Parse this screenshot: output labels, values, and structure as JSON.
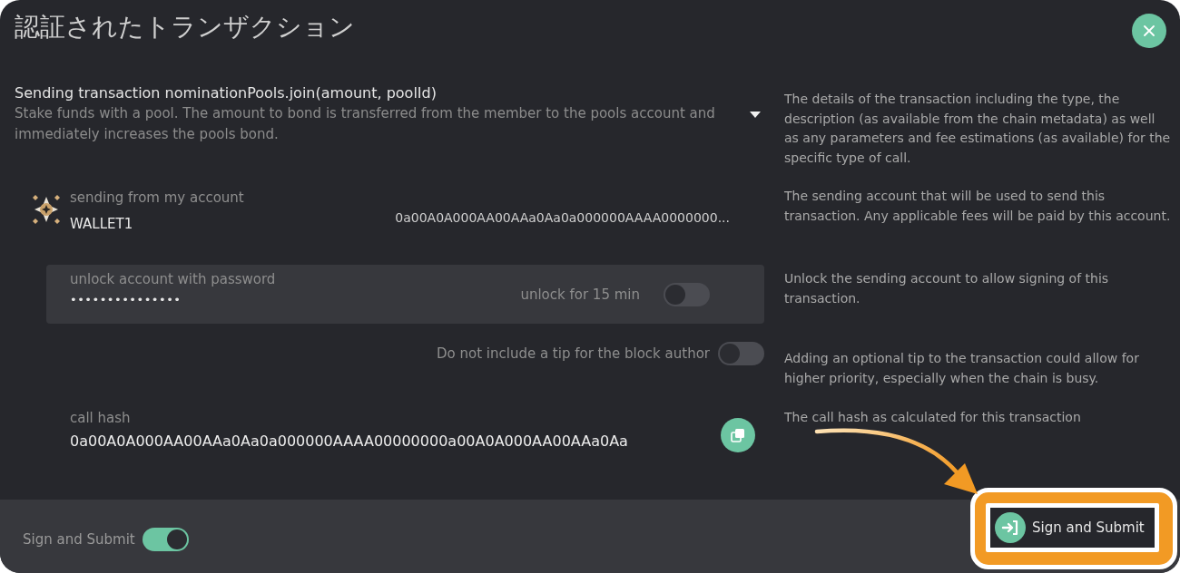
{
  "dialog": {
    "title": "認証されたトランザクション"
  },
  "transaction": {
    "heading": "Sending transaction nominationPools.join(amount, poolId)",
    "description": "Stake funds with a pool. The amount to bond is transferred from the member to the pools account and immediately increases the pools bond.",
    "expanded": false,
    "help": "The details of the transaction including the type, the description (as available from the chain metadata) as well as any parameters and fee estimations (as available) for the specific type of call."
  },
  "sender": {
    "label": "sending from my account",
    "name": "WALLET1",
    "address": "0a00A0A000AA00AAa0Aa0a000000AAAA0000000...",
    "help": "The sending account that will be used to send this transaction. Any applicable fees will be paid by this account."
  },
  "unlock": {
    "label": "unlock account with password",
    "password": "•••••••••••••••",
    "toggle_label": "unlock for 15 min",
    "on": false,
    "help": "Unlock the sending account to allow signing of this transaction."
  },
  "tip": {
    "label": "Do not include a tip for the block author",
    "on": false,
    "help": "Adding an optional tip to the transaction could allow for higher priority, especially when the chain is busy."
  },
  "call_hash": {
    "label": "call hash",
    "value": "0a00A0A000AA00AAa0Aa0a000000AAAA00000000a00A0A000AA00AAa0Aa",
    "help": "The call hash as calculated for this transaction"
  },
  "footer": {
    "toggle_label": "Sign and Submit",
    "on": true,
    "button": "Sign and Submit"
  }
}
